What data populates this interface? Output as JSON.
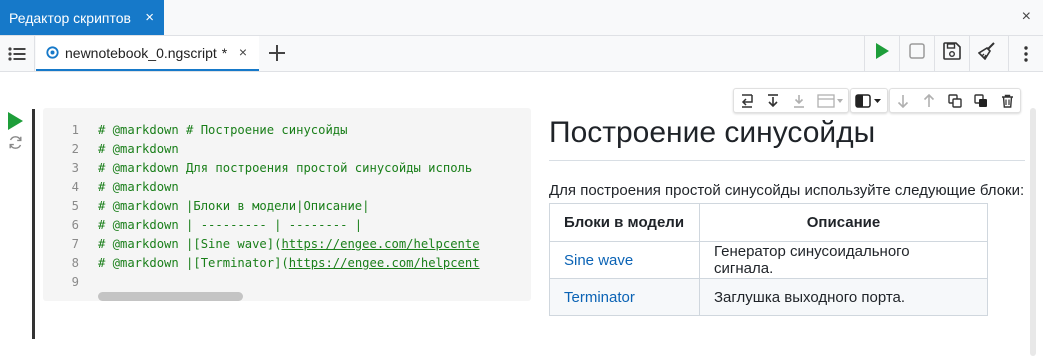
{
  "window": {
    "title": "Редактор скриптов",
    "close_glyph": "×"
  },
  "tabs": [
    {
      "label": "newnotebook_0.ngscript",
      "dirty_mark": "*",
      "close_glyph": "×",
      "icon": "notebook-file-icon"
    }
  ],
  "toolbar": {
    "list_icon": "list-icon",
    "add_icon": "plus-icon",
    "run_icon": "play-icon",
    "stop_icon": "stop-icon",
    "save_icon": "save-icon",
    "clear_icon": "broom-icon",
    "more_icon": "more-vertical-icon"
  },
  "colors": {
    "accent": "#1679c9",
    "run_green": "#1e9e3a",
    "code_comment": "#1a7f1a",
    "link": "#0b63b5"
  },
  "cell": {
    "code_lines": [
      {
        "n": "1",
        "text": "# @markdown # Построение синусойды"
      },
      {
        "n": "2",
        "text": "# @markdown"
      },
      {
        "n": "3",
        "text": "# @markdown Для построения простой синусойды исполь"
      },
      {
        "n": "4",
        "text": "# @markdown"
      },
      {
        "n": "5",
        "text": "# @markdown |Блоки в модели|Описание|"
      },
      {
        "n": "6",
        "text": "# @markdown | --------- | -------- |"
      },
      {
        "n": "7",
        "pre": "# @markdown |[Sine wave](",
        "url": "https://engee.com/helpcente"
      },
      {
        "n": "8",
        "pre": "# @markdown |[Terminator](",
        "url": "https://engee.com/helpcent"
      },
      {
        "n": "9",
        "text": ""
      }
    ],
    "toolbar_icons": [
      "insert-below-icon",
      "move-down-to-icon",
      "download-icon",
      "cell-type-icon",
      "theme-toggle-icon",
      "arrow-down-icon",
      "arrow-up-icon",
      "copy-icon",
      "copy-output-icon",
      "delete-icon"
    ]
  },
  "markdown": {
    "heading": "Построение синусойды",
    "paragraph": "Для построения простой синусойды используйте следующие блоки:",
    "table": {
      "headers": [
        "Блоки в модели",
        "Описание"
      ],
      "rows": [
        {
          "block": "Sine wave",
          "desc": "Генератор синусоидального сигнала."
        },
        {
          "block": "Terminator",
          "desc": "Заглушка выходного порта."
        }
      ]
    }
  }
}
